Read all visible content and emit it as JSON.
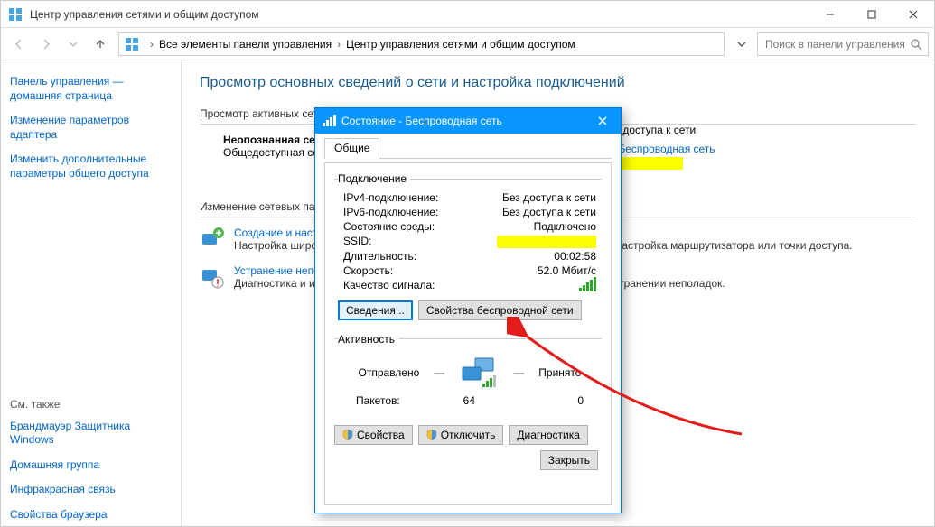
{
  "window": {
    "title": "Центр управления сетями и общим доступом"
  },
  "breadcrumb": {
    "part1": "Все элементы панели управления",
    "part2": "Центр управления сетями и общим доступом"
  },
  "search": {
    "placeholder": "Поиск в панели управления"
  },
  "sidebar": {
    "home": "Панель управления — домашняя страница",
    "l1": "Изменение параметров адаптера",
    "l2": "Изменить дополнительные параметры общего доступа",
    "also": "См. также",
    "a1": "Брандмауэр Защитника Windows",
    "a2": "Домашняя группа",
    "a3": "Инфракрасная связь",
    "a4": "Свойства браузера"
  },
  "main": {
    "heading": "Просмотр основных сведений о сети и настройка подключений",
    "active_label": "Просмотр активных сетей",
    "unknown_net": "Неопознанная сеть",
    "public_net": "Общедоступная сеть",
    "access_label": "Тип доступа к сети",
    "connections_link": "Беспроводная сеть",
    "change_label": "Изменение сетевых параметров",
    "e1_title": "Создание и настройка нового подключения или сети",
    "e1_sub": "Настройка широкополосного, коммутируемого или VPN-подключения либо настройка маршрутизатора или точки доступа.",
    "e2_title": "Устранение неполадок",
    "e2_sub": "Диагностика и исправление проблем с сетью или получение сведений об устранении неполадок."
  },
  "dialog": {
    "title": "Состояние - Беспроводная сеть",
    "tab": "Общие",
    "group_conn": "Подключение",
    "ipv4_k": "IPv4-подключение:",
    "ipv4_v": "Без доступа к сети",
    "ipv6_k": "IPv6-подключение:",
    "ipv6_v": "Без доступа к сети",
    "media_k": "Состояние среды:",
    "media_v": "Подключено",
    "ssid_k": "SSID:",
    "dur_k": "Длительность:",
    "dur_v": "00:02:58",
    "speed_k": "Скорость:",
    "speed_v": "52.0 Мбит/с",
    "sig_k": "Качество сигнала:",
    "btn_details": "Сведения...",
    "btn_wprops": "Свойства беспроводной сети",
    "group_act": "Активность",
    "sent": "Отправлено",
    "recv": "Принято",
    "packets_k": "Пакетов:",
    "packets_sent": "64",
    "packets_recv": "0",
    "btn_props": "Свойства",
    "btn_disable": "Отключить",
    "btn_diag": "Диагностика",
    "btn_close": "Закрыть"
  }
}
